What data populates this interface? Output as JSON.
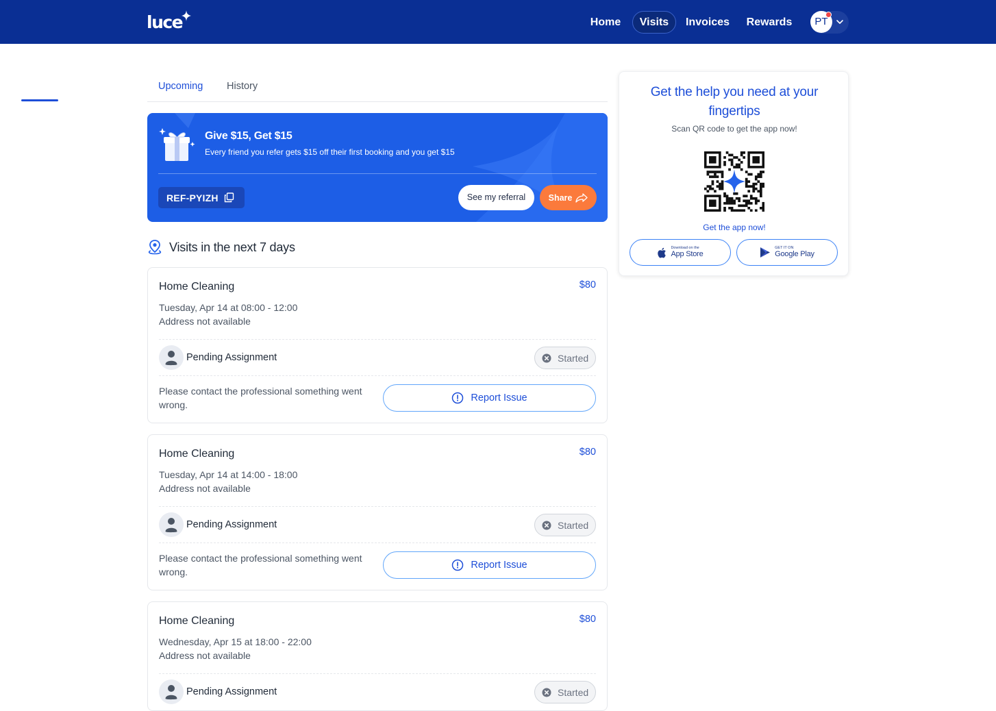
{
  "header": {
    "logo_text": "luce",
    "nav": [
      {
        "label": "Home",
        "active": false
      },
      {
        "label": "Visits",
        "active": true
      },
      {
        "label": "Invoices",
        "active": false
      },
      {
        "label": "Rewards",
        "active": false
      }
    ],
    "avatar_initials": "PT",
    "brand_color": "#0a2f94"
  },
  "tabs": [
    {
      "label": "Upcoming",
      "active": true
    },
    {
      "label": "History",
      "active": false
    }
  ],
  "referral": {
    "title": "Give $15, Get $15",
    "subtitle": "Every friend you refer gets $15 off their first booking and you get $15",
    "code": "REF-PYIZH",
    "see_label": "See my referral",
    "share_label": "Share"
  },
  "section": {
    "title": "Visits in the next 7 days",
    "icon": "location-pin-icon"
  },
  "visits": [
    {
      "service": "Home Cleaning",
      "price": "$80",
      "time": "Tuesday, Apr 14 at 08:00 - 12:00",
      "address": "Address not available",
      "professional": "Pending Assignment",
      "status": "Started",
      "note": "Please contact the professional something went wrong.",
      "report_label": "Report Issue"
    },
    {
      "service": "Home Cleaning",
      "price": "$80",
      "time": "Tuesday, Apr 14 at 14:00 - 18:00",
      "address": "Address not available",
      "professional": "Pending Assignment",
      "status": "Started",
      "note": "Please contact the professional something went wrong.",
      "report_label": "Report Issue"
    },
    {
      "service": "Home Cleaning",
      "price": "$80",
      "time": "Wednesday, Apr 15 at 18:00 - 22:00",
      "address": "Address not available",
      "professional": "Pending Assignment",
      "status": "Started"
    }
  ],
  "app_promo": {
    "title": "Get the help you need at your fingertips",
    "subtitle": "Scan QR code to get the app now!",
    "cta": "Get the app now!",
    "app_store_small": "Download on the",
    "app_store_big": "App Store",
    "google_small": "GET IT ON",
    "google_big": "Google Play"
  }
}
